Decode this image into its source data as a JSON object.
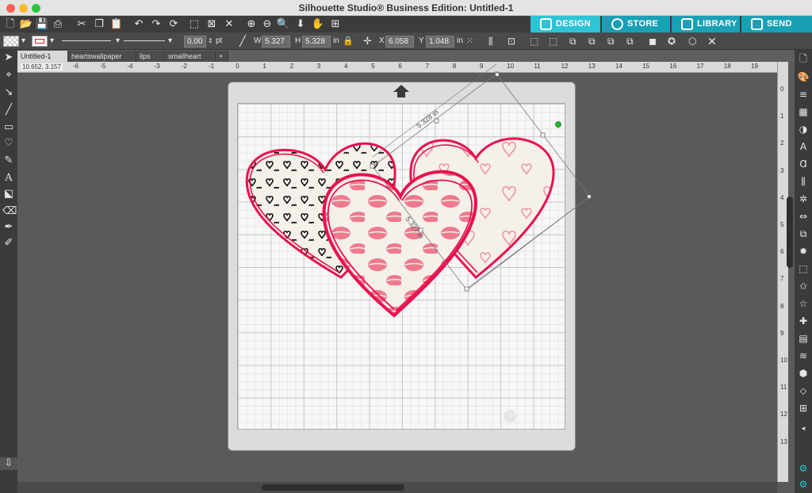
{
  "window": {
    "title": "Silhouette Studio® Business Edition: Untitled-1"
  },
  "nav_tabs": [
    {
      "label": "DESIGN",
      "color": "#2ec4d6"
    },
    {
      "label": "STORE",
      "color": "#1aa0b5"
    },
    {
      "label": "LIBRARY",
      "color": "#1aa0b5"
    },
    {
      "label": "SEND",
      "color": "#1aa0b5"
    }
  ],
  "line_style": {
    "width_value": "0.00",
    "width_unit": "pt"
  },
  "transform": {
    "w_label": "W",
    "w_value": "5.327",
    "h_label": "H",
    "h_value": "5.328",
    "unit": "in",
    "x_label": "X",
    "x_value": "6.058",
    "y_label": "Y",
    "y_value": "1.048"
  },
  "doc_tabs": [
    {
      "label": "Untitled-1",
      "active": true
    },
    {
      "label": "heartswallpaper",
      "active": false
    },
    {
      "label": "lips",
      "active": false
    },
    {
      "label": "smallheart",
      "active": false
    },
    {
      "label": "+",
      "active": false
    }
  ],
  "cursor_readout": {
    "x": "10.652",
    "y": "3.157"
  },
  "ruler_h": [
    "-6",
    "-5",
    "-4",
    "-3",
    "-2",
    "-1",
    "0",
    "1",
    "2",
    "3",
    "4",
    "5",
    "6",
    "7",
    "8",
    "9",
    "10",
    "11",
    "12",
    "13",
    "14",
    "15",
    "16",
    "17",
    "18",
    "19"
  ],
  "ruler_v": [
    "0",
    "1",
    "2",
    "3",
    "4",
    "5",
    "6",
    "7",
    "8",
    "9",
    "10",
    "11",
    "12",
    "13"
  ],
  "selection": {
    "width_label": "5.328 in",
    "height_label": "5.327 in"
  },
  "colors": {
    "accent": "#2ec4d6",
    "heart_outline": "#e8114f",
    "lips": "#ee6b84",
    "selection_handle": "#22aa22"
  }
}
